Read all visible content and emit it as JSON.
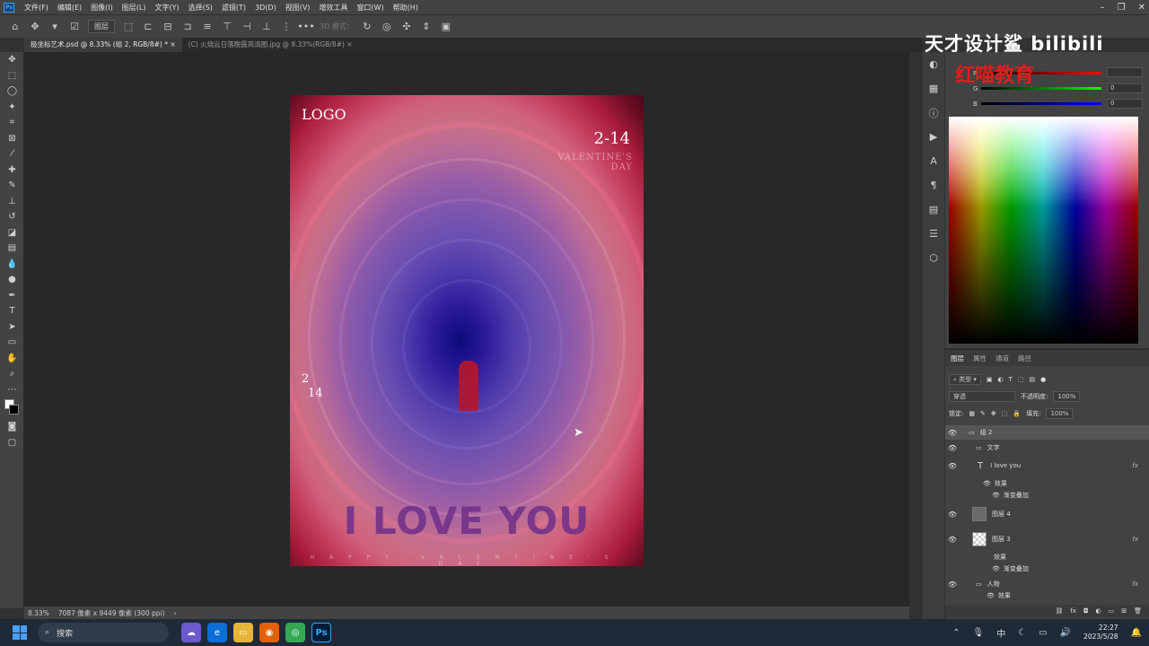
{
  "menubar": {
    "items": [
      "文件(F)",
      "编辑(E)",
      "图像(I)",
      "图层(L)",
      "文字(Y)",
      "选择(S)",
      "滤镜(T)",
      "3D(D)",
      "视图(V)",
      "增效工具",
      "窗口(W)",
      "帮助(H)"
    ]
  },
  "options_bar": {
    "layer_select": "图层",
    "mode_3d": "3D 模式："
  },
  "tabs": [
    {
      "label": "极坐标艺术.psd @ 8.33% (组 2, RGB/8#) *",
      "active": true
    },
    {
      "label": "(C) 火烧云日落晚霞高清图.jpg @ 8.33%(RGB/8#)",
      "active": false
    }
  ],
  "poster": {
    "logo": "LOGO",
    "date": "2-14",
    "valentines_line1": "VALENTINE'S",
    "valentines_line2": "DAY",
    "num_a": "2",
    "num_b": "14",
    "headline": "I LOVE YOU",
    "footer": "HAPPY VALENTINE'S DAY"
  },
  "status": {
    "zoom": "8.33%",
    "doc_info": "7087 像素 x 9449 像素 (300 ppi)",
    "arrow": "›"
  },
  "watermark": {
    "line1": "天才设计鲨 bilibili",
    "line2": "红喵教育"
  },
  "color_panel": {
    "r_label": "R",
    "g_label": "G",
    "b_label": "B",
    "r_value": "",
    "g_value": "0",
    "b_value": "0"
  },
  "layers_panel": {
    "tabs": [
      "图层",
      "属性",
      "通道",
      "路径"
    ],
    "filter_label": "类型",
    "blend_mode": "穿透",
    "opacity_label": "不透明度:",
    "opacity_value": "100%",
    "lock_label": "锁定:",
    "fill_label": "填充:",
    "fill_value": "100%",
    "layers": [
      {
        "name": "组 2",
        "kind": "group"
      },
      {
        "name": "文字",
        "kind": "group"
      },
      {
        "name": "I love you",
        "kind": "text",
        "fx": "fx"
      },
      {
        "name": "效果",
        "kind": "effects"
      },
      {
        "name": "渐变叠加",
        "kind": "effect"
      },
      {
        "name": "图层 4",
        "kind": "pixel"
      },
      {
        "name": "图层 3",
        "kind": "pixel",
        "fx": "fx"
      },
      {
        "name": "效果",
        "kind": "effects"
      },
      {
        "name": "渐变叠加",
        "kind": "effect"
      },
      {
        "name": "人物",
        "kind": "group",
        "fx": "fx"
      },
      {
        "name": "效果",
        "kind": "effects"
      }
    ]
  },
  "taskbar": {
    "search": "搜索",
    "ime": "中",
    "time": "22:27",
    "date": "2023/5/28"
  }
}
